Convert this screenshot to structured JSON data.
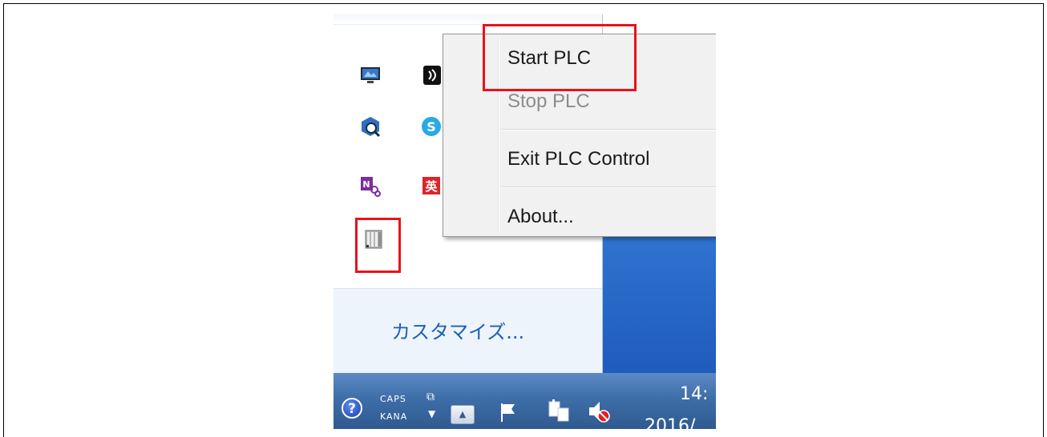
{
  "tray": {
    "customize_link": "カスタマイズ..."
  },
  "context_menu": {
    "items": [
      {
        "label": "Start PLC",
        "enabled": true
      },
      {
        "label": "Stop PLC",
        "enabled": false
      },
      {
        "label": "Exit PLC Control",
        "enabled": true
      },
      {
        "label": "About...",
        "enabled": true
      }
    ]
  },
  "taskbar": {
    "caps_label": "CAPS",
    "kana_label": "KANA",
    "clock_time": "14:",
    "clock_date": "2016/"
  },
  "colors": {
    "highlight": "#e8121b",
    "link": "#1d5fb8",
    "taskbar": "#3e6ea8"
  }
}
